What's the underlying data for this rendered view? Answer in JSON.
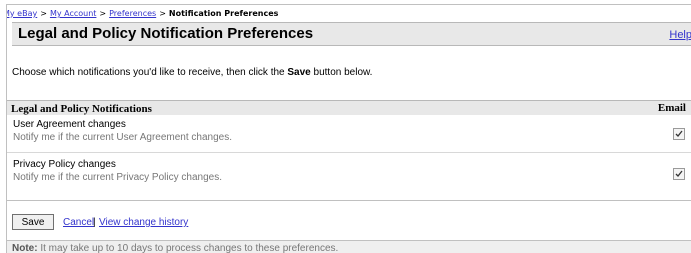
{
  "breadcrumb": {
    "items": [
      "My eBay",
      "My Account",
      "Preferences"
    ],
    "separator": ">",
    "current": "Notification Preferences"
  },
  "header": {
    "title": "Legal and Policy Notification Preferences",
    "help": "Help"
  },
  "intro": {
    "before": "Choose which notifications you'd like to receive, then click the ",
    "bold": "Save",
    "after": " button below."
  },
  "section": {
    "title": "Legal and Policy Notifications",
    "email_header": "Email",
    "items": [
      {
        "name": "User Agreement changes",
        "description": "Notify me if the current User Agreement changes.",
        "email_checked": true
      },
      {
        "name": "Privacy Policy changes",
        "description": "Notify me if the current Privacy Policy changes.",
        "email_checked": true
      }
    ]
  },
  "actions": {
    "save": "Save",
    "cancel": "Cancel",
    "separator": "|",
    "history": "View change history"
  },
  "note": {
    "label": "Note:",
    "text": " It may take up to 10 days to process changes to these preferences."
  },
  "colors": {
    "link": "#3333cc",
    "header_bg": "#e8e8e8",
    "muted_text": "#777777"
  }
}
